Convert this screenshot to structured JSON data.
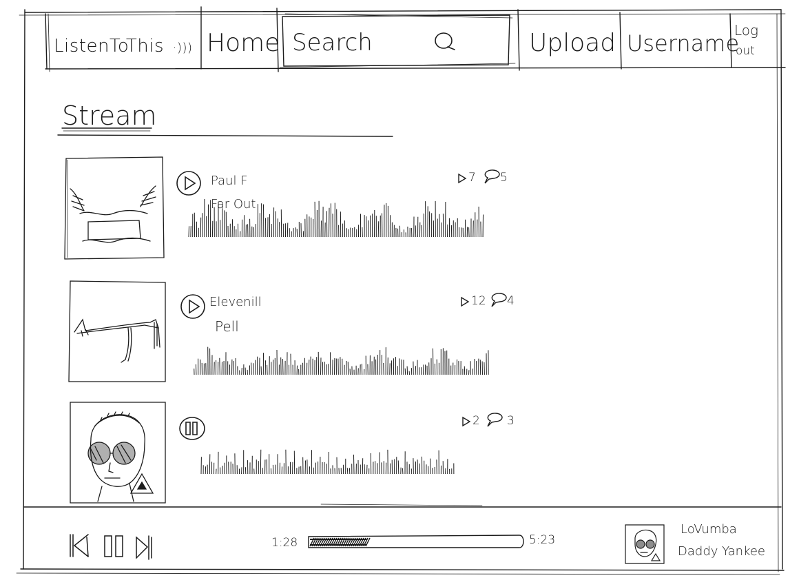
{
  "header": {
    "logo": "ListenToThis",
    "logo_waves": "·)))",
    "home": "Home",
    "search_placeholder": "Search",
    "upload": "Upload",
    "username": "Username",
    "logout_line1": "Log",
    "logout_line2": "out"
  },
  "stream": {
    "title": "Stream",
    "tracks": [
      {
        "artist": "Paul F",
        "title": "Far Out",
        "plays": "7",
        "comments": "5",
        "state": "paused"
      },
      {
        "artist": "Elevenill",
        "title": "Pell",
        "plays": "12",
        "comments": "4",
        "state": "paused"
      },
      {
        "artist": "",
        "title": "",
        "plays": "2",
        "comments": "3",
        "state": "playing"
      }
    ]
  },
  "player": {
    "elapsed": "1:28",
    "duration": "5:23",
    "progress": 0.27,
    "now_playing_title": "LoVumba",
    "now_playing_artist": "Daddy Yankee"
  },
  "icons": {
    "play": "play-icon",
    "pause": "pause-icon",
    "skip_back": "skip-back-icon",
    "skip_forward": "skip-forward-icon",
    "search": "search-icon",
    "plays": "play-count-icon",
    "comments": "comment-icon"
  },
  "colors": {
    "ink": "#1c1c1c",
    "paper": "#ffffff"
  }
}
